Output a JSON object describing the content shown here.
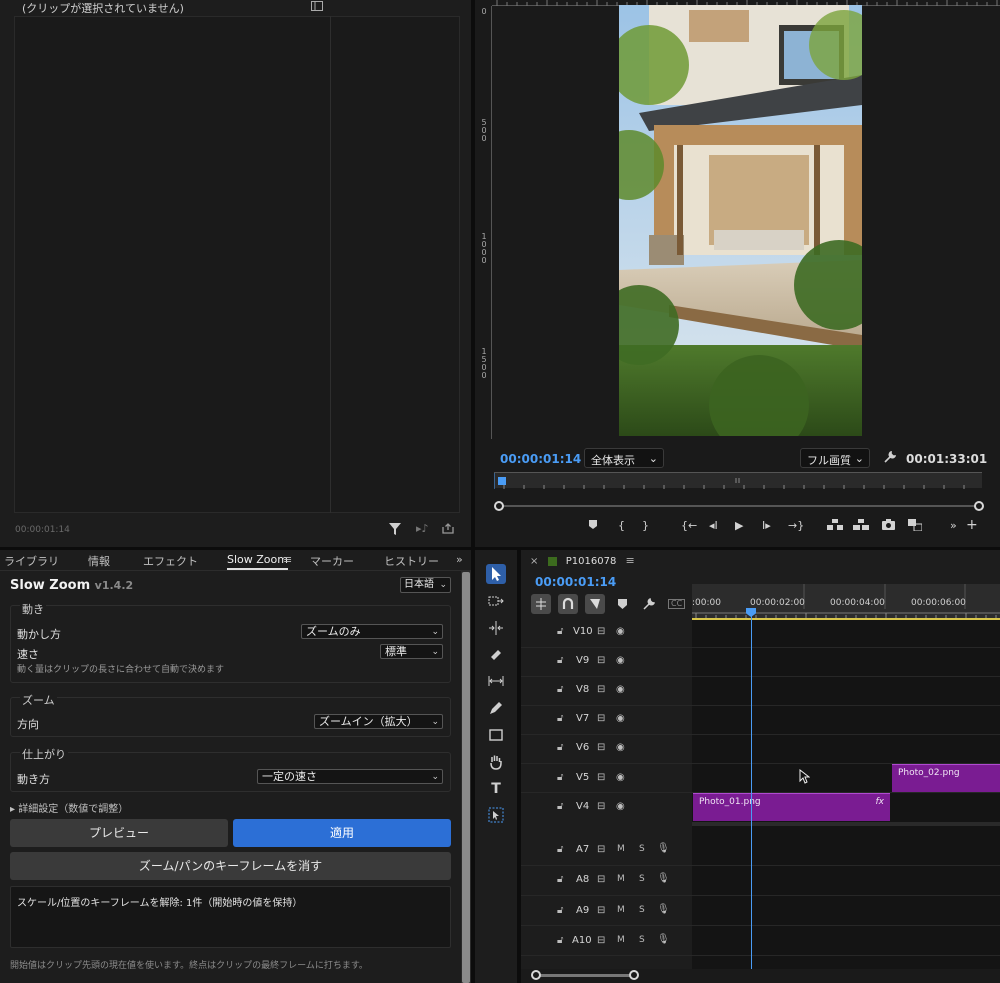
{
  "source_panel": {
    "title": "(クリップが選択されていません)",
    "timecode": "00:00:01:14"
  },
  "program_monitor": {
    "ruler_marks": [
      "0",
      "500",
      "1000",
      "1500"
    ],
    "timecode_current": "00:00:01:14",
    "fit_label": "全体表示",
    "quality_label": "フル画質",
    "timecode_duration": "00:01:33:01",
    "controls": [
      "marker-icon",
      "in-point-icon",
      "out-point-icon",
      "go-to-in-icon",
      "step-back-icon",
      "play-icon",
      "step-forward-icon",
      "go-to-out-icon",
      "lift-icon",
      "extract-icon",
      "export-frame-icon",
      "comparison-view-icon",
      "more-icon",
      "add-icon"
    ]
  },
  "tabs": {
    "items": [
      "ライブラリ",
      "情報",
      "エフェクト",
      "Slow Zoom",
      "マーカー",
      "ヒストリー"
    ],
    "active": "Slow Zoom"
  },
  "slow_zoom": {
    "title": "Slow Zoom",
    "version": "v1.4.2",
    "language": "日本語",
    "motion": {
      "section": "動き",
      "method_label": "動かし方",
      "method_value": "ズームのみ",
      "speed_label": "速さ",
      "speed_value": "標準",
      "hint": "動く量はクリップの長さに合わせて自動で決めます"
    },
    "zoom": {
      "section": "ズーム",
      "direction_label": "方向",
      "direction_value": "ズームイン（拡大）"
    },
    "finish": {
      "section": "仕上がり",
      "motion_label": "動き方",
      "motion_value": "一定の速さ"
    },
    "advanced_label": "▸ 詳細設定（数値で調整）",
    "preview_button": "プレビュー",
    "apply_button": "適用",
    "clear_button": "ズーム/パンのキーフレームを消す",
    "log": "スケール/位置のキーフレームを解除: 1件（開始時の値を保持）",
    "footnote": "開始値はクリップ先頭の現在値を使います。終点はクリップの最終フレームに打ちます。"
  },
  "timeline": {
    "sequence_name": "P1016078",
    "timecode": "00:00:01:14",
    "ruler_times": [
      ":00:00",
      "00:00:02:00",
      "00:00:04:00",
      "00:00:06:00"
    ],
    "video_tracks": [
      "V10",
      "V9",
      "V8",
      "V7",
      "V6",
      "V5",
      "V4"
    ],
    "audio_tracks": [
      "A7",
      "A8",
      "A9",
      "A10"
    ],
    "audio_buttons": {
      "mute": "M",
      "solo": "S"
    },
    "clips": [
      {
        "name": "Photo_01.png",
        "track": "V4",
        "has_fx": true,
        "fx_label": "fx"
      },
      {
        "name": "Photo_02.png",
        "track": "V5",
        "has_fx": false
      }
    ],
    "clip_color": "#7a1c92",
    "playhead_color": "#4a9cf5"
  }
}
